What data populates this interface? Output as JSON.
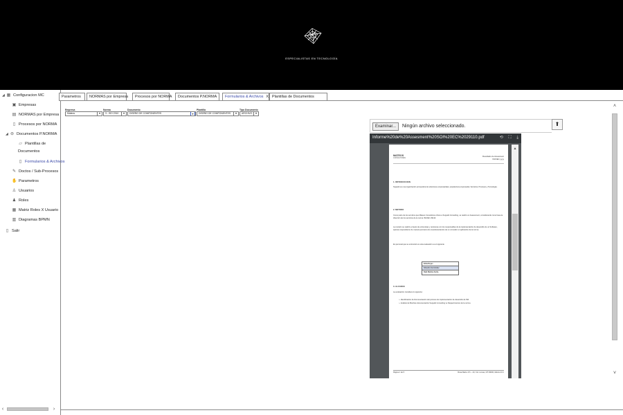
{
  "header": {
    "tagline": "ESPECIALISTAS EN TECNOLOGÍA"
  },
  "sidebar": {
    "items": [
      {
        "label": "Configuracion MC"
      },
      {
        "label": "Empresas"
      },
      {
        "label": "NORMAS por Empresa"
      },
      {
        "label": "Procesos por NORMA"
      },
      {
        "label": "Documentos P.NORMA"
      },
      {
        "label": "Plantillas de"
      },
      {
        "label": "Documentos"
      },
      {
        "label": "Formularios & Archivos"
      },
      {
        "label": "Doctos / Sub-Procesos"
      },
      {
        "label": "Parametros"
      },
      {
        "label": "Usuarios"
      },
      {
        "label": "Roles"
      },
      {
        "label": "Matriz Roles X Usuario"
      },
      {
        "label": "Diagramas BPMN"
      },
      {
        "label": "Salir"
      }
    ]
  },
  "tabs": [
    {
      "label": "Parametros"
    },
    {
      "label": "NORMAS por Empresa"
    },
    {
      "label": "Procesos por NORMA"
    },
    {
      "label": "Documentos P.NORMA"
    },
    {
      "label": "Formularios & Archivos",
      "close": "X"
    },
    {
      "label": "Plantillas de Documentos"
    }
  ],
  "filters": {
    "empresa": {
      "label": "Empresa",
      "value": "Mateos"
    },
    "norma": {
      "label": "Norma",
      "value": "3 - ISO 2910"
    },
    "documento": {
      "label": "Documento",
      "value": "DISEÑO DE COMPONENTES"
    },
    "plantilla": {
      "label": "Plantilla",
      "value": "DISEÑO DE COMPONENTES"
    },
    "tipo": {
      "label": "Tipo Documento",
      "value": "ARCHIVO"
    }
  },
  "upload": {
    "browse_label": "Examinar...",
    "file_name": "Ningún archivo seleccionado."
  },
  "viewer": {
    "filename": "Informe%20de%20Assesment%20SOI%20EC%2029110.pdf",
    "document": {
      "brand": "MATEOS",
      "brand_sub": "CONSULTORES",
      "report_title_1": "Resultado de Assesment",
      "report_title_2": "ISO/IEC yyyy",
      "h1": "1.   INTRODUCCION",
      "p1": "Suppelk  es una organización  proveedora de soluciones empresariales, arquitectura empresarial, Servicios, Procesos y Tecnología.",
      "h2": "2.   METODO",
      "p2": "Como parte de los servicios que Mateos Consultores ofrece a Suppelk Consulting, se realizó un Assessment, considerando como base la dirección de los servicios de la norma ISO/IEC 29110.",
      "p3": "La revisión se realizó a través de entrevistas y revisiones  con los responsables de la implementación de desarrollo de un Software, quienes respondieron de manera puntual a los cuestionamientos de un consultor en aplicación de la norma.",
      "p4": "EL personal que se entrevistó en esta evaluación es el siguiente",
      "people": [
        "Erika Reyes",
        "Eduardo Hernández",
        "Raúl Medina Zurita"
      ],
      "h3": "3.   ALCANCE",
      "p5": "La evaluación considera lo siguiente:",
      "b1": "➢   Identificación de Documentación del proceso de implementación de desarrollo de SW",
      "b2": "➢   Análisis de Brechas documentación Suppelk Consulting vs Requerimientos de la norma",
      "footer_left": "Página 1 de 5",
      "footer_right": "Rosa María 171 – 23, Col. Lomas, CP 09000, México D.F."
    }
  }
}
